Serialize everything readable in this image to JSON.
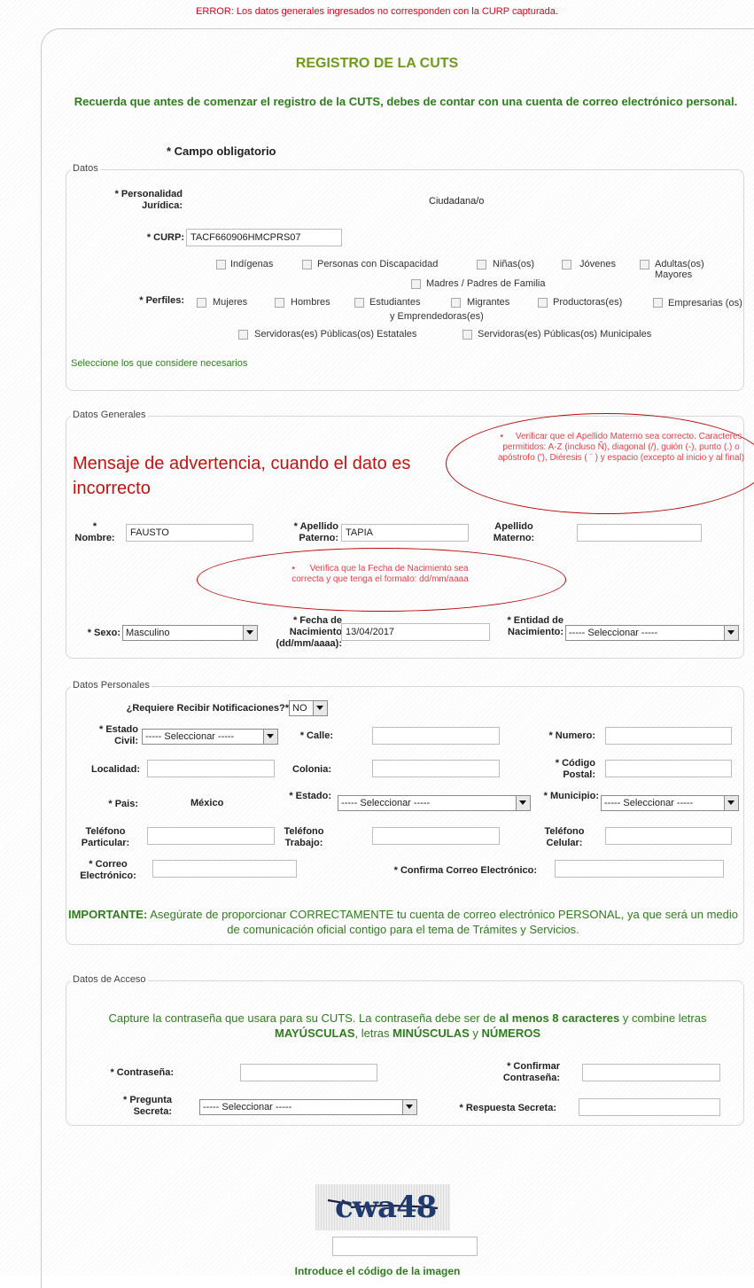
{
  "error_message": "ERROR: Los datos generales ingresados no corresponden con la CURP capturada.",
  "title": "REGISTRO DE LA CUTS",
  "intro": "Recuerda que antes de comenzar el registro de la CUTS, debes de contar con una cuenta de correo electrónico personal.",
  "required_note": "* Campo obligatorio",
  "datos": {
    "legend": "Datos",
    "personalidad_label": "* Personalidad Jurídica:",
    "personalidad_value": "Ciudadana/o",
    "curp_label": "* CURP:",
    "curp_value": "TACF660906HMCPRS07",
    "perfiles_label": "* Perfiles:",
    "perfiles": [
      "Indígenas",
      "Personas con Discapacidad",
      "Niñas(os)",
      "Jóvenes",
      "Adultas(os) Mayores",
      "Madres / Padres de Familia",
      "Mujeres",
      "Hombres",
      "Estudiantes",
      "Migrantes",
      "Productoras(es)",
      "Empresarias (os) y Emprendedoras(es)",
      "Servidoras(es) Públicas(os) Estatales",
      "Servidoras(es) Públicas(os) Municipales"
    ],
    "note": "Seleccione los que considere necesarios"
  },
  "datos_generales": {
    "legend": "Datos Generales",
    "annotation": "Mensaje de advertencia, cuando el dato es incorrecto",
    "warn_apellido": "Verificar que el Apellido Materno sea correcto. Caracteres permitidos: A-Z (incluso Ñ), diagonal (/), guión (-), punto (.) o apóstrofo ('), Diéresis ( ¨ ) y espacio (excepto al inicio y al final)",
    "warn_fecha": "Verifica que la Fecha de Nacimiento sea correcta y que tenga el formato: dd/mm/aaaa",
    "bullet": "•",
    "nombre_label": "* Nombre:",
    "nombre_value": "FAUSTO",
    "ap_paterno_label": "* Apellido Paterno:",
    "ap_paterno_value": "TAPIA",
    "ap_materno_label": "Apellido Materno:",
    "ap_materno_value": "",
    "sexo_label": "* Sexo:",
    "sexo_value": "Masculino",
    "fecha_label": "* Fecha de Nacimiento (dd/mm/aaaa):",
    "fecha_value": "13/04/2017",
    "entidad_label": "* Entidad de Nacimiento:",
    "entidad_value": "----- Seleccionar -----"
  },
  "datos_personales": {
    "legend": "Datos Personales",
    "notif_label": "¿Requiere Recibir Notificaciones?*",
    "notif_value": "NO",
    "estado_civil_label": "* Estado Civil:",
    "estado_civil_value": "----- Seleccionar -----",
    "calle_label": "* Calle:",
    "numero_label": "* Numero:",
    "localidad_label": "Localidad:",
    "colonia_label": "Colonia:",
    "cp_label": "* Código Postal:",
    "pais_label": "* Pais:",
    "pais_value": "México",
    "estado_label": "* Estado:",
    "estado_value": "----- Seleccionar -----",
    "municipio_label": "* Municipio:",
    "municipio_value": "----- Seleccionar -----",
    "tel_part_label": "Teléfono Particular:",
    "tel_trab_label": "Teléfono Trabajo:",
    "tel_cel_label": "Teléfono Celular:",
    "correo_label": "* Correo Electrónico:",
    "confirma_correo_label": "* Confirma Correo Electrónico:",
    "important_bold": "IMPORTANTE:",
    "important_text": " Asegúrate de proporcionar CORRECTAMENTE tu cuenta de correo electrónico PERSONAL, ya que será un medio de comunicación oficial contigo para el tema de Trámites y Servicios."
  },
  "datos_acceso": {
    "legend": "Datos de Acceso",
    "note_1": "Capture la contraseña que usara para su CUTS. La contraseña debe ser de ",
    "note_b1": "al menos 8 caracteres",
    "note_2": " y combine letras ",
    "note_b2": "MAYÚSCULAS",
    "note_3": ", letras ",
    "note_b3": "MINÚSCULAS",
    "note_4": " y ",
    "note_b4": "NÚMEROS",
    "pass_label": "* Contraseña:",
    "confirm_pass_label": "* Confirmar Contraseña:",
    "pregunta_label": "* Pregunta Secreta:",
    "pregunta_value": "----- Seleccionar -----",
    "respuesta_label": "* Respuesta Secreta:"
  },
  "captcha": {
    "image_text": "cwa48",
    "label": "Introduce el código de la imagen"
  }
}
